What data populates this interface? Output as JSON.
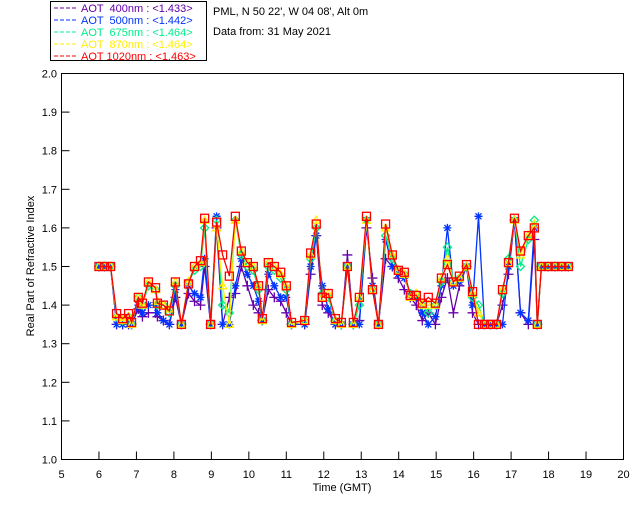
{
  "header": {
    "site": "PML, N 50 22', W 04 08', Alt 0m",
    "date": "Data from: 31 May 2021"
  },
  "chart_data": {
    "type": "line",
    "title": "",
    "xlabel": "Time (GMT)",
    "ylabel": "Real Part of Refractive Index",
    "xlim": [
      5,
      20
    ],
    "ylim": [
      1.0,
      2.0
    ],
    "xticks": [
      "5",
      "6",
      "7",
      "8",
      "9",
      "10",
      "11",
      "12",
      "13",
      "14",
      "15",
      "16",
      "17",
      "18",
      "19",
      "20"
    ],
    "yticks": [
      "1.0",
      "1.1",
      "1.2",
      "1.3",
      "1.4",
      "1.5",
      "1.6",
      "1.7",
      "1.8",
      "1.9",
      "2.0"
    ],
    "grid": false,
    "legend_position": "top-left-outside",
    "x": [
      6.0,
      6.15,
      6.31,
      6.47,
      6.63,
      6.79,
      6.87,
      7.05,
      7.16,
      7.32,
      7.51,
      7.56,
      7.72,
      7.88,
      8.04,
      8.2,
      8.39,
      8.55,
      8.71,
      8.82,
      8.98,
      9.14,
      9.3,
      9.48,
      9.64,
      9.8,
      9.96,
      10.12,
      10.26,
      10.36,
      10.52,
      10.68,
      10.85,
      11.0,
      11.14,
      11.49,
      11.65,
      11.8,
      11.96,
      12.12,
      12.31,
      12.47,
      12.63,
      12.79,
      12.95,
      13.14,
      13.3,
      13.46,
      13.65,
      13.83,
      13.99,
      14.15,
      14.31,
      14.47,
      14.63,
      14.79,
      14.98,
      15.14,
      15.3,
      15.46,
      15.62,
      15.81,
      15.97,
      16.13,
      16.29,
      16.45,
      16.61,
      16.77,
      16.93,
      17.09,
      17.25,
      17.46,
      17.62,
      17.7,
      17.81,
      17.99,
      18.17,
      18.35,
      18.53
    ],
    "series": [
      {
        "name": "AOT  400nm : <1.433>",
        "color": "#6600aa",
        "marker": "plus",
        "values": [
          1.5,
          1.5,
          1.5,
          1.35,
          1.35,
          1.35,
          1.35,
          1.39,
          1.37,
          1.38,
          1.38,
          1.37,
          1.36,
          1.35,
          1.42,
          1.35,
          1.43,
          1.41,
          1.4,
          1.5,
          1.35,
          1.6,
          1.35,
          1.42,
          1.43,
          1.5,
          1.45,
          1.4,
          1.38,
          1.36,
          1.44,
          1.42,
          1.41,
          1.38,
          1.35,
          1.35,
          1.48,
          1.58,
          1.4,
          1.38,
          1.35,
          1.35,
          1.53,
          1.35,
          1.36,
          1.6,
          1.47,
          1.35,
          1.52,
          1.5,
          1.47,
          1.44,
          1.42,
          1.4,
          1.36,
          1.38,
          1.35,
          1.42,
          1.47,
          1.38,
          1.45,
          1.5,
          1.38,
          1.35,
          1.35,
          1.35,
          1.35,
          1.4,
          1.48,
          1.62,
          1.38,
          1.35,
          1.57,
          1.35,
          1.5,
          1.5,
          1.5,
          1.5,
          1.5
        ]
      },
      {
        "name": "AOT  500nm : <1.442>",
        "color": "#0033ff",
        "marker": "asterisk",
        "values": [
          1.5,
          1.5,
          1.5,
          1.35,
          1.35,
          1.35,
          1.35,
          1.4,
          1.38,
          1.4,
          1.4,
          1.38,
          1.36,
          1.35,
          1.44,
          1.35,
          1.45,
          1.43,
          1.42,
          1.52,
          1.35,
          1.63,
          1.35,
          1.35,
          1.45,
          1.52,
          1.48,
          1.45,
          1.41,
          1.36,
          1.48,
          1.45,
          1.42,
          1.42,
          1.35,
          1.35,
          1.5,
          1.58,
          1.45,
          1.39,
          1.35,
          1.35,
          1.5,
          1.35,
          1.35,
          1.62,
          1.45,
          1.35,
          1.57,
          1.5,
          1.48,
          1.47,
          1.43,
          1.42,
          1.38,
          1.35,
          1.37,
          1.45,
          1.6,
          1.45,
          1.46,
          1.5,
          1.4,
          1.63,
          1.35,
          1.35,
          1.35,
          1.35,
          1.5,
          1.62,
          1.38,
          1.36,
          1.6,
          1.35,
          1.5,
          1.5,
          1.5,
          1.5,
          1.5
        ]
      },
      {
        "name": "AOT  675nm : <1.464>",
        "color": "#00ee88",
        "marker": "diamond",
        "values": [
          1.5,
          1.5,
          1.5,
          1.37,
          1.36,
          1.37,
          1.35,
          1.42,
          1.4,
          1.45,
          1.44,
          1.4,
          1.4,
          1.38,
          1.45,
          1.35,
          1.46,
          1.49,
          1.5,
          1.6,
          1.35,
          1.62,
          1.4,
          1.38,
          1.62,
          1.53,
          1.5,
          1.49,
          1.44,
          1.36,
          1.5,
          1.49,
          1.47,
          1.44,
          1.35,
          1.36,
          1.52,
          1.6,
          1.43,
          1.42,
          1.36,
          1.35,
          1.5,
          1.35,
          1.4,
          1.62,
          1.44,
          1.35,
          1.58,
          1.52,
          1.49,
          1.48,
          1.43,
          1.43,
          1.4,
          1.38,
          1.4,
          1.46,
          1.55,
          1.46,
          1.47,
          1.5,
          1.42,
          1.4,
          1.35,
          1.35,
          1.35,
          1.43,
          1.52,
          1.62,
          1.5,
          1.57,
          1.62,
          1.35,
          1.5,
          1.5,
          1.5,
          1.5,
          1.5
        ]
      },
      {
        "name": "AOT  870nm : <1.464>",
        "color": "#ffee00",
        "marker": "triangle",
        "values": [
          1.5,
          1.5,
          1.5,
          1.37,
          1.36,
          1.37,
          1.35,
          1.42,
          1.4,
          1.46,
          1.44,
          1.41,
          1.4,
          1.39,
          1.46,
          1.35,
          1.46,
          1.5,
          1.51,
          1.62,
          1.35,
          1.6,
          1.45,
          1.35,
          1.62,
          1.54,
          1.51,
          1.5,
          1.45,
          1.36,
          1.51,
          1.5,
          1.48,
          1.45,
          1.35,
          1.36,
          1.53,
          1.62,
          1.42,
          1.43,
          1.36,
          1.35,
          1.5,
          1.35,
          1.42,
          1.62,
          1.44,
          1.35,
          1.6,
          1.53,
          1.49,
          1.48,
          1.42,
          1.43,
          1.4,
          1.4,
          1.4,
          1.47,
          1.52,
          1.46,
          1.47,
          1.5,
          1.43,
          1.38,
          1.35,
          1.35,
          1.35,
          1.44,
          1.51,
          1.62,
          1.53,
          1.58,
          1.61,
          1.35,
          1.5,
          1.5,
          1.5,
          1.5,
          1.5
        ]
      },
      {
        "name": "AOT 1020nm : <1.463>",
        "color": "#ff0000",
        "marker": "square",
        "values": [
          1.5,
          1.5,
          1.5,
          1.378,
          1.365,
          1.378,
          1.355,
          1.42,
          1.405,
          1.46,
          1.445,
          1.405,
          1.4,
          1.385,
          1.46,
          1.35,
          1.455,
          1.5,
          1.515,
          1.625,
          1.35,
          1.615,
          1.53,
          1.475,
          1.63,
          1.54,
          1.51,
          1.5,
          1.45,
          1.365,
          1.51,
          1.5,
          1.485,
          1.45,
          1.355,
          1.36,
          1.535,
          1.61,
          1.42,
          1.43,
          1.365,
          1.355,
          1.5,
          1.355,
          1.42,
          1.63,
          1.44,
          1.35,
          1.61,
          1.53,
          1.49,
          1.485,
          1.425,
          1.425,
          1.405,
          1.42,
          1.405,
          1.47,
          1.505,
          1.46,
          1.475,
          1.505,
          1.435,
          1.35,
          1.35,
          1.35,
          1.35,
          1.44,
          1.51,
          1.625,
          1.54,
          1.58,
          1.6,
          1.35,
          1.5,
          1.5,
          1.5,
          1.5,
          1.5
        ]
      }
    ]
  }
}
